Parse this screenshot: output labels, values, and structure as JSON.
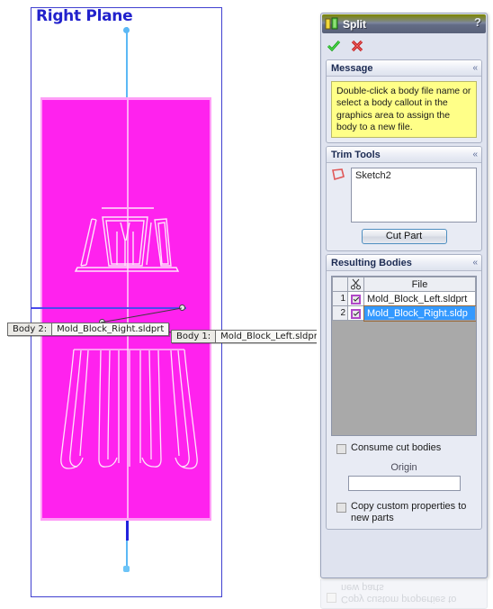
{
  "graphics": {
    "plane_label": "Right Plane",
    "callouts": [
      {
        "key": "Body  2:",
        "value": "Mold_Block_Right.sldprt"
      },
      {
        "key": "Body  1:",
        "value": "Mold_Block_Left.sldprt"
      }
    ],
    "colors": {
      "body_fill": "#ff22ee",
      "plane_border": "#4040d0",
      "plane_label": "#2222cc",
      "centerline": "#5bb8f5",
      "sketch_line": "#4a4aee"
    }
  },
  "panel": {
    "title": "Split",
    "title_icon": "split-icon",
    "help_glyph": "?",
    "accept_icon": "green-check-icon",
    "cancel_icon": "red-x-icon",
    "message": {
      "title": "Message",
      "collapse_glyph": "«",
      "text": "Double-click a body file name or select a body callout in the graphics area to assign the body to a new file."
    },
    "trim_tools": {
      "title": "Trim Tools",
      "collapse_glyph": "«",
      "selection_icon": "plane-selection-icon",
      "items": [
        "Sketch2"
      ],
      "cut_part_label": "Cut Part"
    },
    "resulting_bodies": {
      "title": "Resulting Bodies",
      "collapse_glyph": "«",
      "columns": {
        "num": "",
        "scissors": "scissors-icon",
        "file": "File"
      },
      "rows": [
        {
          "num": "1",
          "checked": true,
          "file": "Mold_Block_Left.sldprt",
          "selected": false
        },
        {
          "num": "2",
          "checked": true,
          "file": "Mold_Block_Right.sldp",
          "selected": true
        }
      ]
    },
    "options": {
      "consume_cut_bodies": {
        "label": "Consume cut bodies",
        "checked": false
      },
      "origin_label": "Origin",
      "origin_value": "",
      "copy_custom_properties": {
        "label": "Copy custom properties to new parts",
        "checked": false
      }
    }
  }
}
